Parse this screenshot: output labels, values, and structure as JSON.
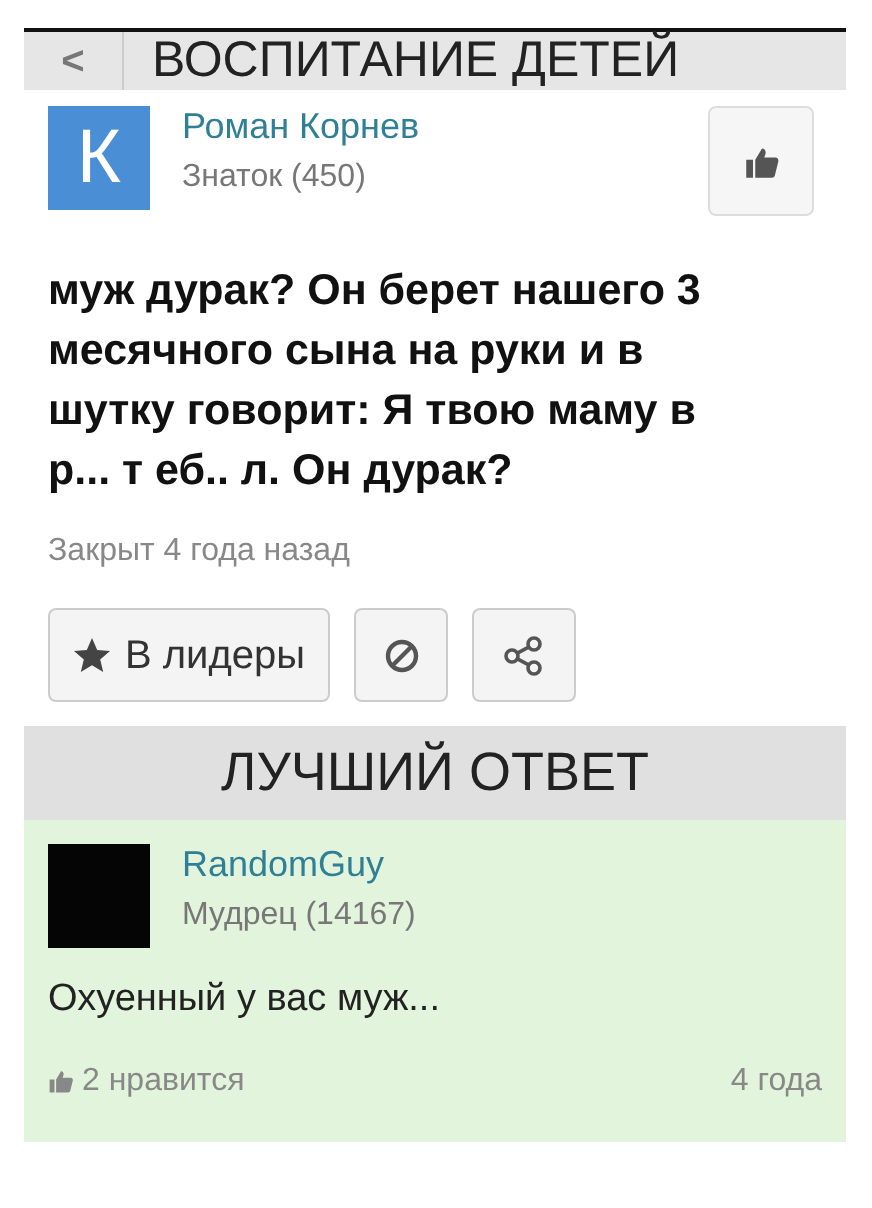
{
  "header": {
    "back": "<",
    "title": "ВОСПИТАНИЕ ДЕТЕЙ"
  },
  "question": {
    "avatar_letter": "К",
    "author": "Роман Корнев",
    "rank": "Знаток (450)",
    "text": "муж дурак? Он берет нашего 3 месячного сына на руки и в шутку говорит: Я твою маму в р... т еб.. л. Он дурак?",
    "status": "Закрыт 4 года назад",
    "leader_button": "В лидеры"
  },
  "best_answer": {
    "heading": "ЛУЧШИЙ ОТВЕТ",
    "author": "RandomGuy",
    "rank": "Мудрец (14167)",
    "text": "Охуенный у вас муж...",
    "likes": "2 нравится",
    "age": "4 года"
  }
}
